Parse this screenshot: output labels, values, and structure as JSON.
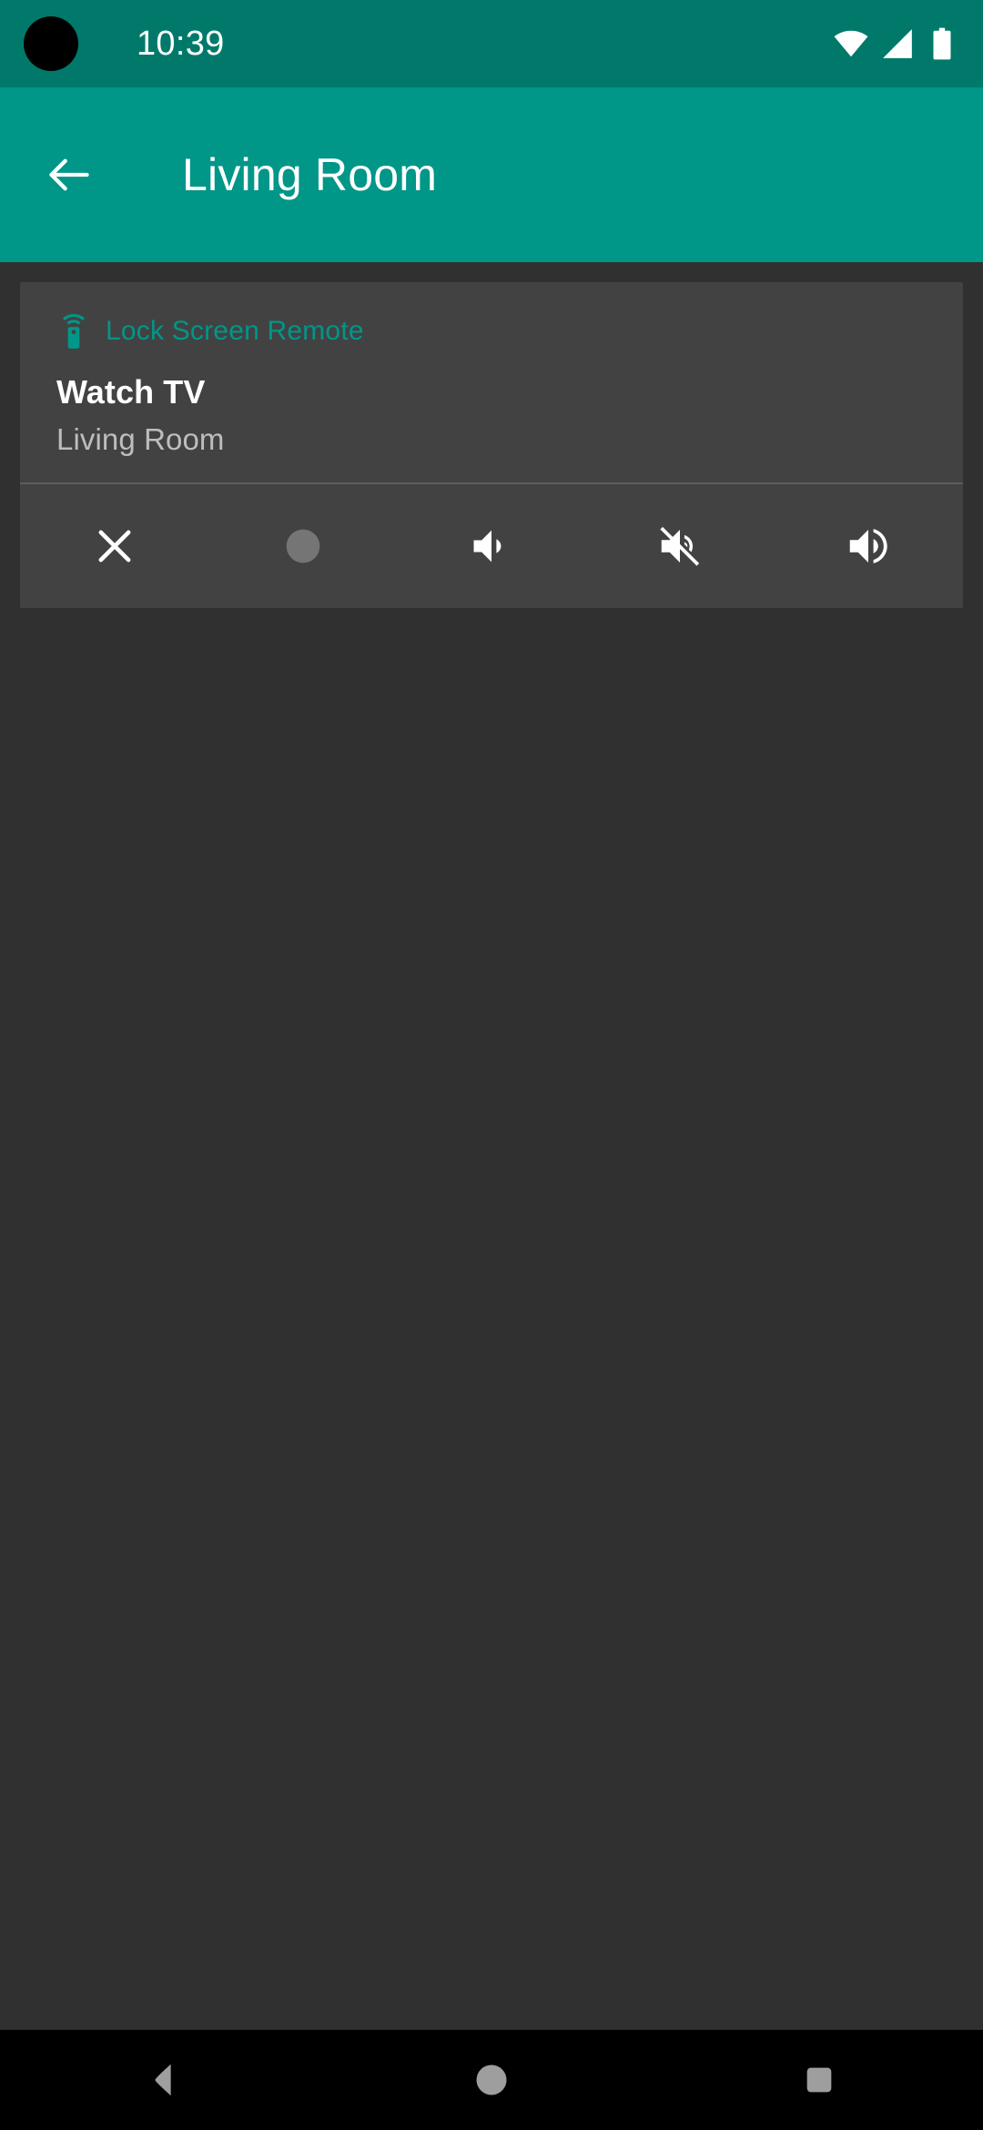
{
  "status_bar": {
    "time": "10:39",
    "icons": [
      {
        "name": "wifi-icon",
        "label": "Wi-Fi full signal"
      },
      {
        "name": "cellular-icon",
        "label": "Cellular signal"
      },
      {
        "name": "battery-icon",
        "label": "Battery full"
      }
    ],
    "background_color": "#00796B"
  },
  "app_bar": {
    "title": "Living Room",
    "back_label": "Navigate up",
    "back_icon": "arrow-back-icon",
    "background_color": "#009688",
    "text_color": "#FFFFFF"
  },
  "notification": {
    "app_name": "Lock Screen Remote",
    "app_icon": "settings-remote-icon",
    "app_name_color": "#009688",
    "title": "Watch TV",
    "subtitle": "Living Room",
    "card_color": "#424242",
    "actions": [
      {
        "name": "close-button",
        "icon": "close-icon",
        "label": "Close"
      },
      {
        "name": "power-button",
        "icon": "circle-icon",
        "label": "Power"
      },
      {
        "name": "volume-down-button",
        "icon": "volume-down-icon",
        "label": "Volume Down"
      },
      {
        "name": "volume-mute-button",
        "icon": "volume-off-icon",
        "label": "Mute"
      },
      {
        "name": "volume-up-button",
        "icon": "volume-up-icon",
        "label": "Volume Up"
      }
    ]
  },
  "page": {
    "background_color": "#303030"
  },
  "nav_bar": {
    "background_color": "#000000",
    "buttons": [
      {
        "name": "nav-back-button",
        "icon": "triangle-back-icon",
        "label": "Back"
      },
      {
        "name": "nav-home-button",
        "icon": "circle-home-icon",
        "label": "Home"
      },
      {
        "name": "nav-recents-button",
        "icon": "square-recents-icon",
        "label": "Recents"
      }
    ]
  }
}
